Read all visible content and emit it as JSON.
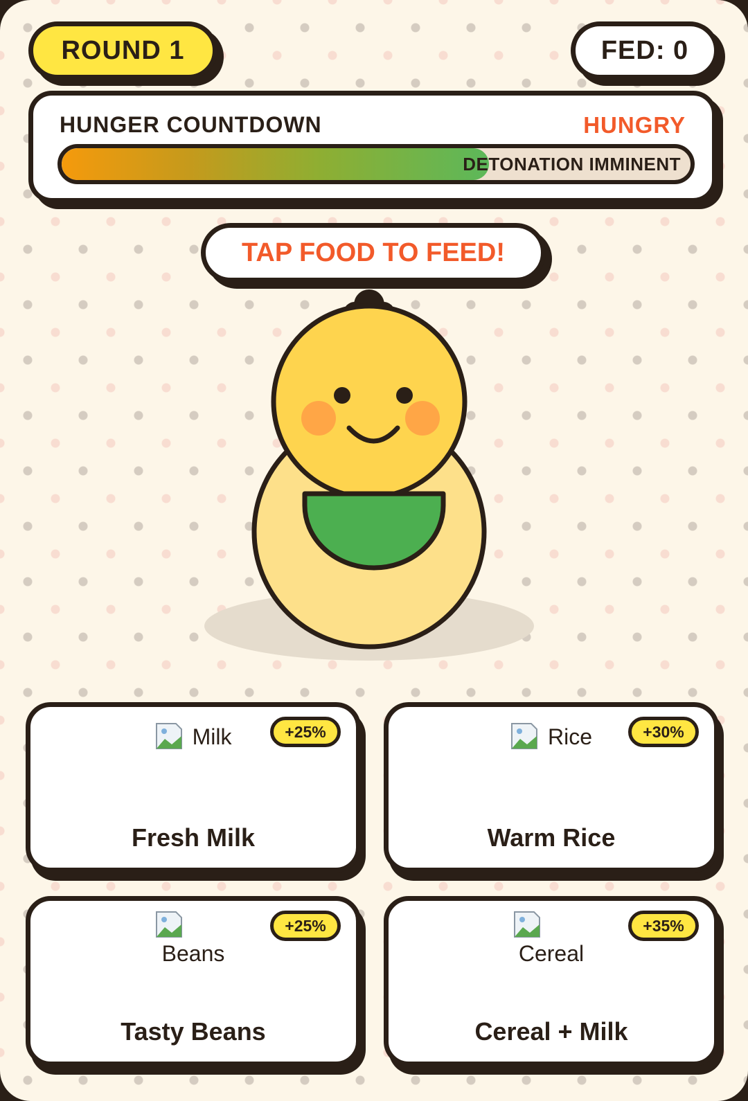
{
  "header": {
    "round_label": "ROUND 1",
    "fed_label": "FED: 0"
  },
  "hunger": {
    "title": "HUNGER COUNTDOWN",
    "status": "HUNGRY",
    "bar_label": "DETONATION IMMINENT",
    "fill_fraction": 0.68
  },
  "prompt": {
    "text": "TAP FOOD TO FEED!"
  },
  "foods": [
    {
      "img_alt": "Milk",
      "badge": "+25%",
      "name": "Fresh Milk"
    },
    {
      "img_alt": "Rice",
      "badge": "+30%",
      "name": "Warm Rice"
    },
    {
      "img_alt": "Beans",
      "badge": "+25%",
      "name": "Tasty Beans"
    },
    {
      "img_alt": "Cereal",
      "badge": "+35%",
      "name": "Cereal + Milk"
    }
  ],
  "colors": {
    "accent_yellow": "#ffe642",
    "alert_orange": "#f25a2a",
    "outline": "#2a1f17",
    "background": "#fdf6e8",
    "bib_green": "#4caf50"
  }
}
